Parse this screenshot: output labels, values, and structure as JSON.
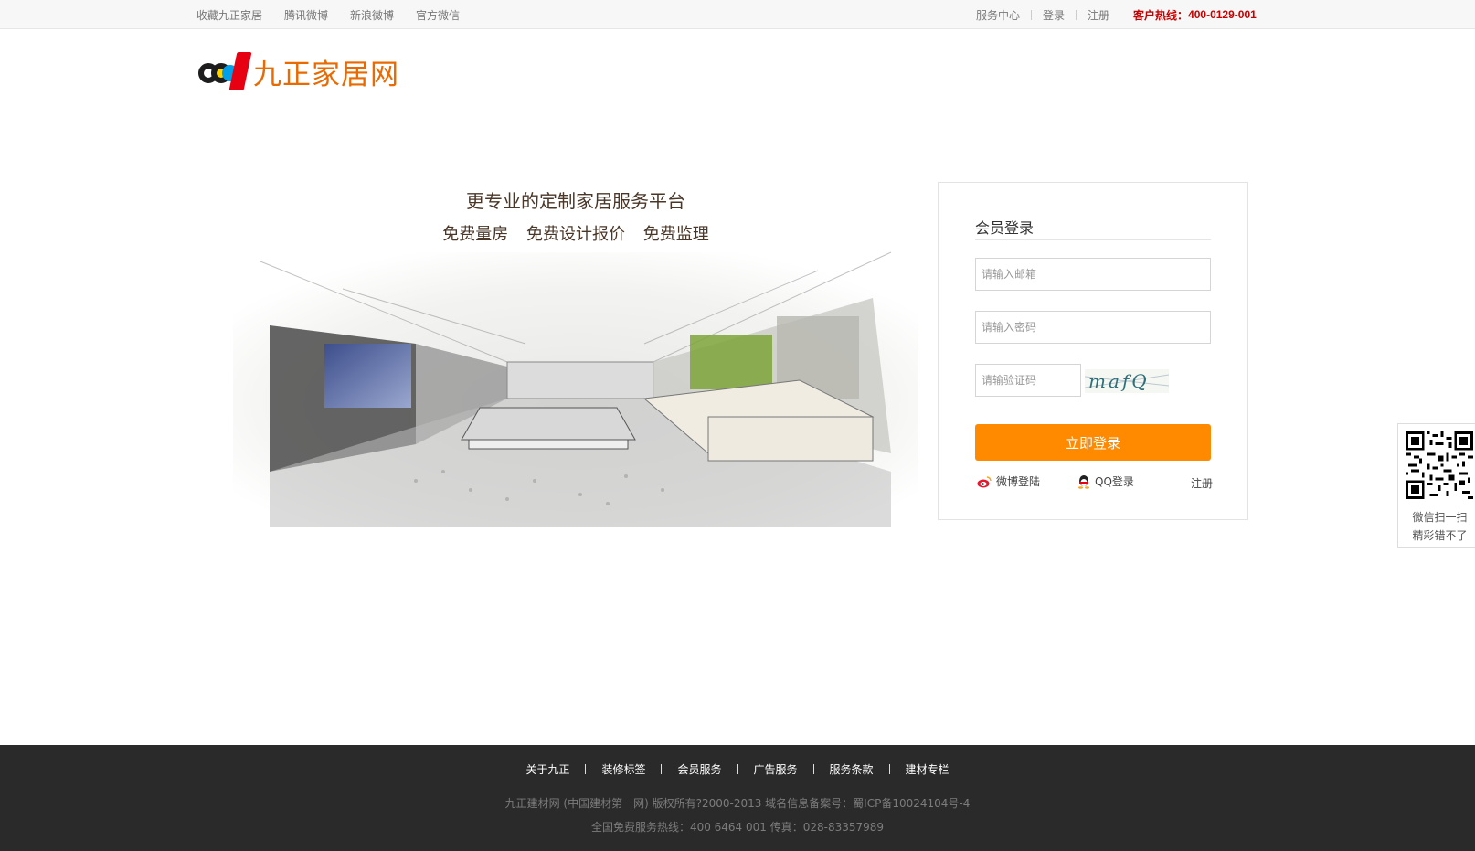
{
  "topbar": {
    "left_links": [
      "收藏九正家居",
      "腾讯微博",
      "新浪微博",
      "官方微信"
    ],
    "right_links": [
      "服务中心",
      "登录",
      "注册"
    ],
    "hotline_label": "客户热线：",
    "hotline_number": "400-0129-001"
  },
  "logo": {
    "text": "九正家居网"
  },
  "banner": {
    "title": "更专业的定制家居服务平台",
    "subtitle": "免费量房  免费设计报价  免费监理"
  },
  "login": {
    "title": "会员登录",
    "email_placeholder": "请输入邮箱",
    "password_placeholder": "请输入密码",
    "captcha_placeholder": "请输验证码",
    "captcha_text": "mafQ",
    "submit_label": "立即登录",
    "weibo_label": "微博登陆",
    "qq_label": "QQ登录",
    "register_label": "注册"
  },
  "qr_float": {
    "line1": "微信扫一扫",
    "line2": "精彩错不了"
  },
  "footer": {
    "links": [
      "关于九正",
      "装修标签",
      "会员服务",
      "广告服务",
      "服务条款",
      "建材专栏"
    ],
    "copyright": "九正建材网 (中国建材第一网)  版权所有?2000-2013    域名信息备案号：蜀ICP备10024104号-4",
    "service_line": "全国免费服务热线：400 6464 001 传真：028-83357989"
  },
  "colors": {
    "accent": "#ff8a00",
    "hotline": "#c40000",
    "footer_bg": "#2a2a2a",
    "logo_orange": "#e86a00"
  }
}
